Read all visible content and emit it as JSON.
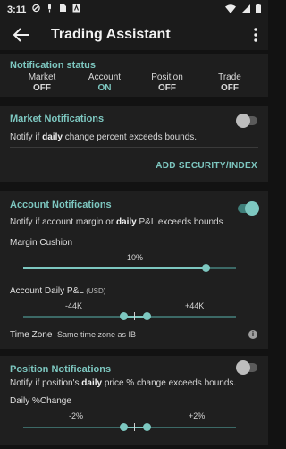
{
  "status_bar": {
    "time": "3:11"
  },
  "app_bar": {
    "title": "Trading Assistant"
  },
  "notification_status": {
    "title": "Notification status",
    "columns": [
      {
        "label": "Market",
        "value": "OFF"
      },
      {
        "label": "Account",
        "value": "ON"
      },
      {
        "label": "Position",
        "value": "OFF"
      },
      {
        "label": "Trade",
        "value": "OFF"
      }
    ]
  },
  "market": {
    "title": "Market Notifications",
    "desc_pre": "Notify if ",
    "desc_bold": "daily",
    "desc_post": " change percent exceeds bounds.",
    "enabled": false,
    "add_button": "ADD SECURITY/INDEX"
  },
  "account": {
    "title": "Account Notifications",
    "desc_pre": "Notify if account margin or ",
    "desc_bold": "daily",
    "desc_post": " P&L exceeds bounds",
    "enabled": true,
    "margin_label": "Margin Cushion",
    "margin_value": "10%",
    "margin_fraction": 0.9,
    "pnl_label": "Account Daily P&L",
    "pnl_unit": "(USD)",
    "pnl_low": "-44K",
    "pnl_high": "+44K",
    "timezone_label": "Time Zone",
    "timezone_value": "Same time zone as IB"
  },
  "position": {
    "title": "Position Notifications",
    "desc_pre": "Notify if position's ",
    "desc_bold": "daily",
    "desc_post": " price % change exceeds bounds.",
    "enabled": false,
    "change_label": "Daily %Change",
    "change_low": "-2%",
    "change_high": "+2%"
  },
  "colors": {
    "accent": "#7dc7c0",
    "background": "#121212",
    "card": "#1f1f1f"
  }
}
